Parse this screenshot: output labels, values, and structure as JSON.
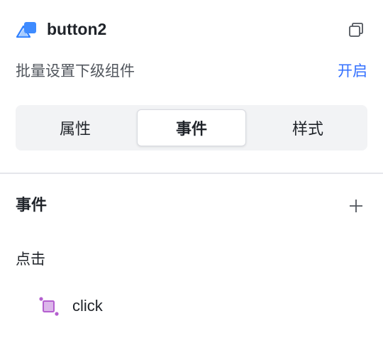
{
  "header": {
    "component_name": "button2",
    "component_icon": "shapes-icon",
    "copy_icon": "copy-icon"
  },
  "batch_setting": {
    "label": "批量设置下级组件",
    "link": "开启",
    "link_color": "#3370ff"
  },
  "tabs": [
    {
      "label": "属性",
      "active": false
    },
    {
      "label": "事件",
      "active": true
    },
    {
      "label": "样式",
      "active": false
    }
  ],
  "events": {
    "title": "事件",
    "add_icon": "plus-icon",
    "groups": [
      {
        "label": "点击",
        "items": [
          {
            "label": "click",
            "icon": "crop-square-icon",
            "icon_color": "#c06fd6"
          }
        ]
      }
    ]
  }
}
